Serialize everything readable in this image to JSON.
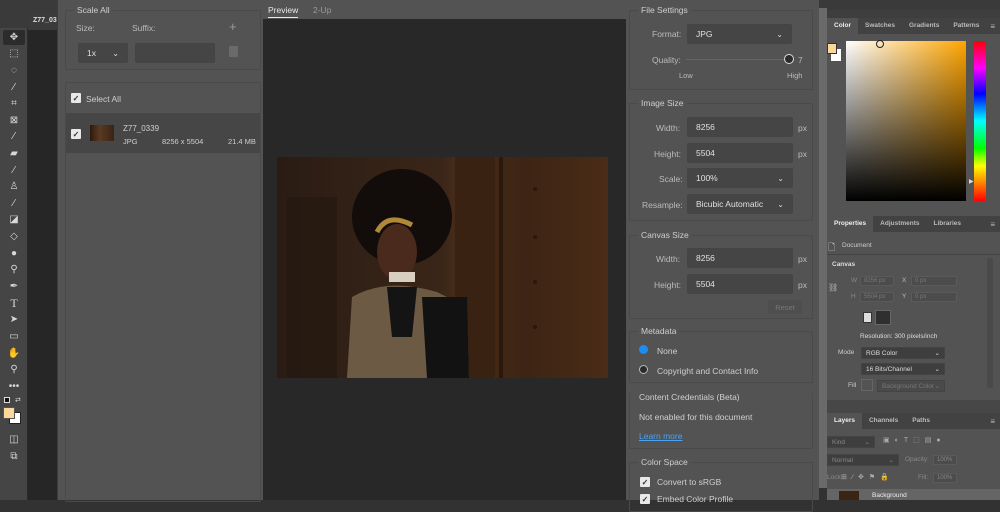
{
  "photoshop": {
    "document_tab": "Z77_03",
    "toolbar_tools": [
      "move",
      "marquee",
      "lasso",
      "magic-wand",
      "crop",
      "frame",
      "eyedropper",
      "healing-brush",
      "brush",
      "clone-stamp",
      "history-brush",
      "eraser",
      "paint-bucket",
      "blur",
      "dodge",
      "pen",
      "type",
      "path-selection",
      "rectangle",
      "hand",
      "zoom",
      "more"
    ],
    "foreground_color": "#fcd79a",
    "background_color": "#ffffff"
  },
  "export_dialog": {
    "scale_all": {
      "title": "Scale All",
      "size_label": "Size:",
      "suffix_label": "Suffix:",
      "size_value": "1x",
      "suffix_value": "",
      "add_label": "+"
    },
    "assets": {
      "select_all_label": "Select All",
      "select_all_checked": true,
      "items": [
        {
          "name": "Z77_0339",
          "format": "JPG",
          "dimensions": "8256 x 5504",
          "size": "21.4 MB",
          "checked": true
        }
      ]
    },
    "preview_tabs": [
      {
        "label": "Preview",
        "active": true
      },
      {
        "label": "2-Up",
        "active": false
      }
    ],
    "file_settings": {
      "title": "File Settings",
      "format_label": "Format:",
      "format_value": "JPG",
      "quality_label": "Quality:",
      "quality_value": "7",
      "quality_fraction": 1.0,
      "low_label": "Low",
      "high_label": "High"
    },
    "image_size": {
      "title": "Image Size",
      "width_label": "Width:",
      "width_value": "8256",
      "height_label": "Height:",
      "height_value": "5504",
      "unit": "px",
      "scale_label": "Scale:",
      "scale_value": "100%",
      "resample_label": "Resample:",
      "resample_value": "Bicubic Automatic"
    },
    "canvas_size": {
      "title": "Canvas Size",
      "width_label": "Width:",
      "width_value": "8256",
      "height_label": "Height:",
      "height_value": "5504",
      "unit": "px",
      "reset_label": "Reset"
    },
    "metadata": {
      "title": "Metadata",
      "options": [
        {
          "label": "None",
          "selected": true
        },
        {
          "label": "Copyright and Contact Info",
          "selected": false
        }
      ]
    },
    "content_credentials": {
      "title": "Content Credentials (Beta)",
      "status": "Not enabled for this document",
      "link": "Learn more"
    },
    "color_space": {
      "title": "Color Space",
      "convert_label": "Convert to sRGB",
      "convert_checked": true,
      "embed_label": "Embed Color Profile",
      "embed_checked": true
    }
  },
  "right_panels": {
    "color_tabs": [
      "Color",
      "Swatches",
      "Gradients",
      "Patterns"
    ],
    "properties_tabs": [
      "Properties",
      "Adjustments",
      "Libraries"
    ],
    "properties": {
      "document_label": "Document",
      "canvas_label": "Canvas",
      "w_label": "W",
      "w_value": "8256 px",
      "h_label": "H",
      "h_value": "5504 px",
      "x_label": "X",
      "x_value": "0 px",
      "y_label": "Y",
      "y_value": "0 px",
      "resolution": "Resolution: 300 pixels/inch",
      "mode_label": "Mode",
      "mode_value": "RGB Color",
      "depth_value": "16 Bits/Channel",
      "fill_label": "Fill",
      "fill_value": "Background Color"
    },
    "layers_tabs": [
      "Layers",
      "Channels",
      "Paths"
    ],
    "layers": {
      "kind_placeholder": "Kind",
      "blend_mode": "Normal",
      "opacity_label": "Opacity:",
      "opacity_value": "100%",
      "lock_label": "Lock:",
      "fill_label": "Fill:",
      "fill_value": "100%",
      "layer_name": "Background"
    }
  }
}
